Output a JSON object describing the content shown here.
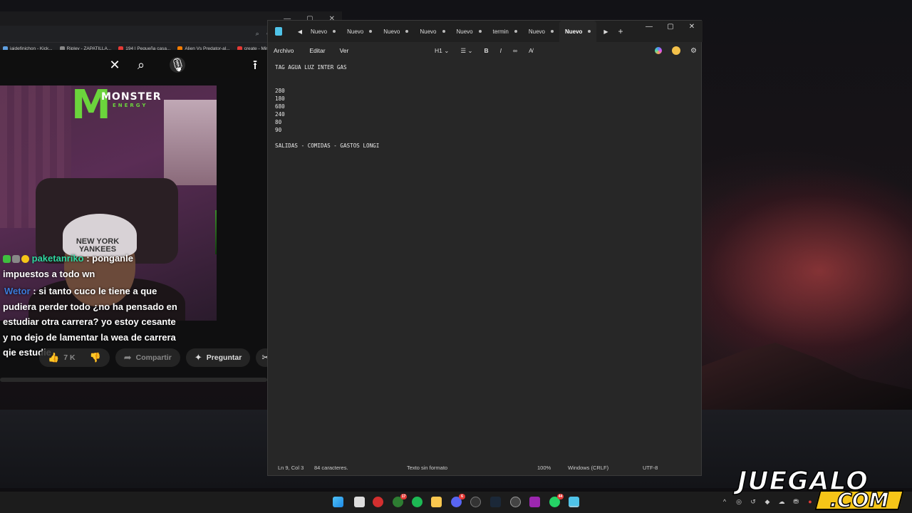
{
  "browser": {
    "bookmarks": [
      "jaidefinichon - Kick...",
      "Ripley - ZAPATILLA...",
      "194 | Pequeña casa...",
      "Alien Vs Predator-al...",
      "create - Minecraft..."
    ],
    "chat": {
      "messages": [
        {
          "user": "paketanriko",
          "text_lines": [
            ": ponganle",
            "impuestos a todo wn"
          ]
        },
        {
          "user": "Wetor",
          "text_lines": [
            ": si tanto cuco le tiene a que",
            "pudiera perder todo ¿no ha pensado en",
            "estudiar otra carrera? yo estoy cesante",
            "y no dejo de lamentar la wea de carrera",
            "qie estudie"
          ]
        }
      ]
    },
    "video": {
      "logo_word": "MONSTER",
      "logo_sub": "ENERGY",
      "cap_text": "NEW YORK YANKEES"
    },
    "actions": {
      "likes": "7 K",
      "share": "Compartir",
      "ask": "Preguntar"
    }
  },
  "notepad": {
    "tabs": [
      "Nuevo",
      "Nuevo",
      "Nuevo",
      "Nuevo",
      "Nuevo",
      "termin",
      "Nuevo",
      "Nuevo"
    ],
    "active_tab_index": 7,
    "menu": {
      "file": "Archivo",
      "edit": "Editar",
      "view": "Ver"
    },
    "toolbar": {
      "heading": "H1"
    },
    "content_lines": [
      "TAG AGUA LUZ INTER GAS",
      "",
      "",
      "280",
      "180",
      "680",
      "240",
      "80",
      "90",
      "",
      "SALIDAS - COMIDAS - GASTOS LONGI"
    ],
    "status": {
      "position": "Ln 9, Col 3",
      "chars": "84 caracteres.",
      "format": "Texto sin formato",
      "zoom": "100%",
      "line_ending": "Windows (CRLF)",
      "encoding": "UTF-8"
    }
  },
  "taskbar": {
    "badges": {
      "xbox": "17",
      "discord": "6",
      "whatsapp": "44"
    }
  },
  "watermark": {
    "line1": "JUEGALO",
    "line2": ".COM"
  }
}
